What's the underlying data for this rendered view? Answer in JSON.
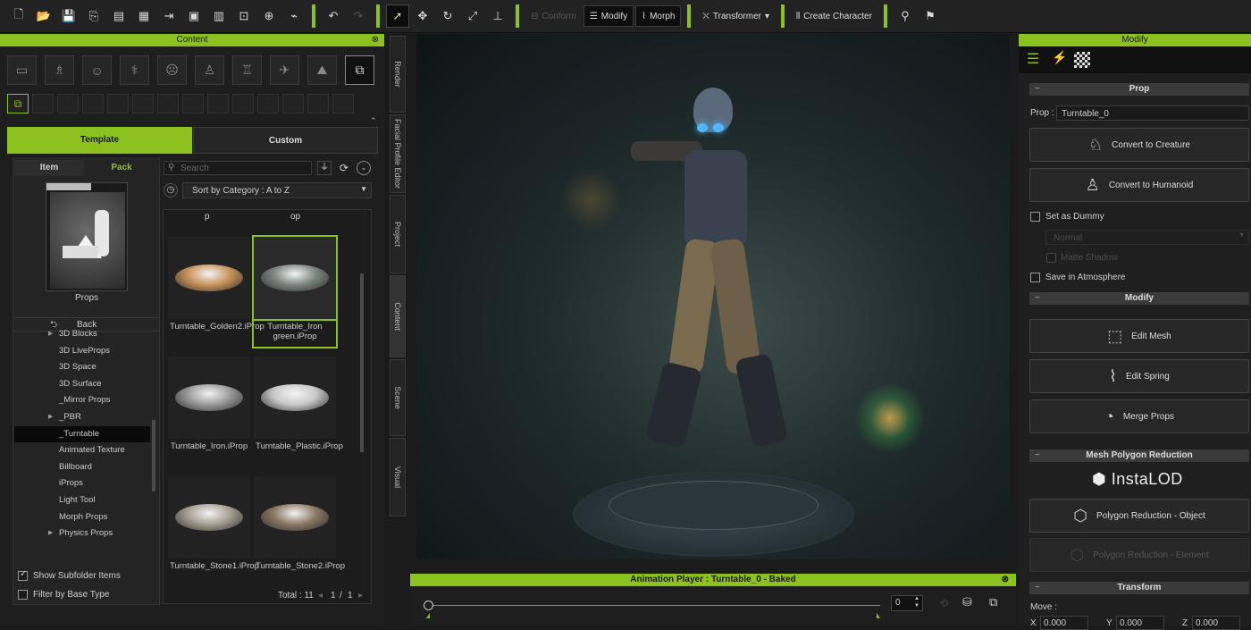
{
  "toolbar": {
    "conform_label": "Conform",
    "modify_label": "Modify",
    "morph_label": "Morph",
    "transformer_label": "Transformer",
    "create_character_label": "Create Character"
  },
  "content_panel": {
    "title": "Content",
    "tabs": {
      "template": "Template",
      "custom": "Custom"
    },
    "subtabs": {
      "item": "Item",
      "pack": "Pack"
    },
    "search_placeholder": "Search",
    "sort_label": "Sort by Category : A to Z",
    "props_label": "Props",
    "back_label": "Back",
    "tree": [
      {
        "label": "3D Blocks",
        "arrow": true
      },
      {
        "label": "3D LiveProps",
        "arrow": false
      },
      {
        "label": "3D Space",
        "arrow": false
      },
      {
        "label": "3D Surface",
        "arrow": false
      },
      {
        "label": "_Mirror Props",
        "arrow": false
      },
      {
        "label": "_PBR",
        "arrow": true
      },
      {
        "label": "_Turntable",
        "arrow": false,
        "selected": true
      },
      {
        "label": "Animated Texture",
        "arrow": false
      },
      {
        "label": "Billboard",
        "arrow": false
      },
      {
        "label": "iProps",
        "arrow": false
      },
      {
        "label": "Light Tool",
        "arrow": false
      },
      {
        "label": "Morph Props",
        "arrow": false
      },
      {
        "label": "Physics Props",
        "arrow": true
      }
    ],
    "partial_top": [
      "p",
      "op"
    ],
    "tiles": [
      {
        "label": "Turntable_Golden2.iProp",
        "color": "#c9935a"
      },
      {
        "label": "Turntable_Iron green.iProp",
        "color": "#7c8580",
        "selected": true
      },
      {
        "label": "Turntable_Iron.iProp",
        "color": "#9a9a9a"
      },
      {
        "label": "Turntable_Plastic.iProp",
        "color": "#c8c8c8"
      },
      {
        "label": "Turntable_Stone1.iProp",
        "color": "#a59f92"
      },
      {
        "label": "Turntable_Stone2.iProp",
        "color": "#8a7864"
      }
    ],
    "show_subfolder": "Show Subfolder Items",
    "filter_base": "Filter by Base Type",
    "total": "Total : 11",
    "page": "1",
    "page_sep": "/",
    "page_total": "1"
  },
  "side_tabs": [
    "Render",
    "Facial Profile Editor",
    "Project",
    "Content",
    "Scene",
    "Visual"
  ],
  "animation_player": {
    "title": "Animation Player : Turntable_0 - Baked",
    "frame": "0"
  },
  "modify_panel": {
    "title": "Modify",
    "prop_section": "Prop",
    "prop_label": "Prop :",
    "prop_value": "Turntable_0",
    "convert_creature": "Convert to Creature",
    "convert_humanoid": "Convert to Humanoid",
    "set_dummy": "Set as Dummy",
    "normal": "Normal",
    "matte_shadow": "Matte Shadow",
    "save_atmosphere": "Save in Atmosphere",
    "modify_section": "Modify",
    "edit_mesh": "Edit Mesh",
    "edit_spring": "Edit Spring",
    "merge_props": "Merge Props",
    "mesh_reduction_section": "Mesh Polygon Reduction",
    "instalod": "InstaLOD",
    "poly_object": "Polygon Reduction - Object",
    "poly_element": "Polygon Reduction - Element",
    "transform_section": "Transform",
    "move_label": "Move :",
    "x_label": "X",
    "y_label": "Y",
    "z_label": "Z",
    "x_value": "0.000",
    "y_value": "0.000",
    "z_value": "0.000"
  },
  "colors": {
    "accent": "#8bc220"
  }
}
